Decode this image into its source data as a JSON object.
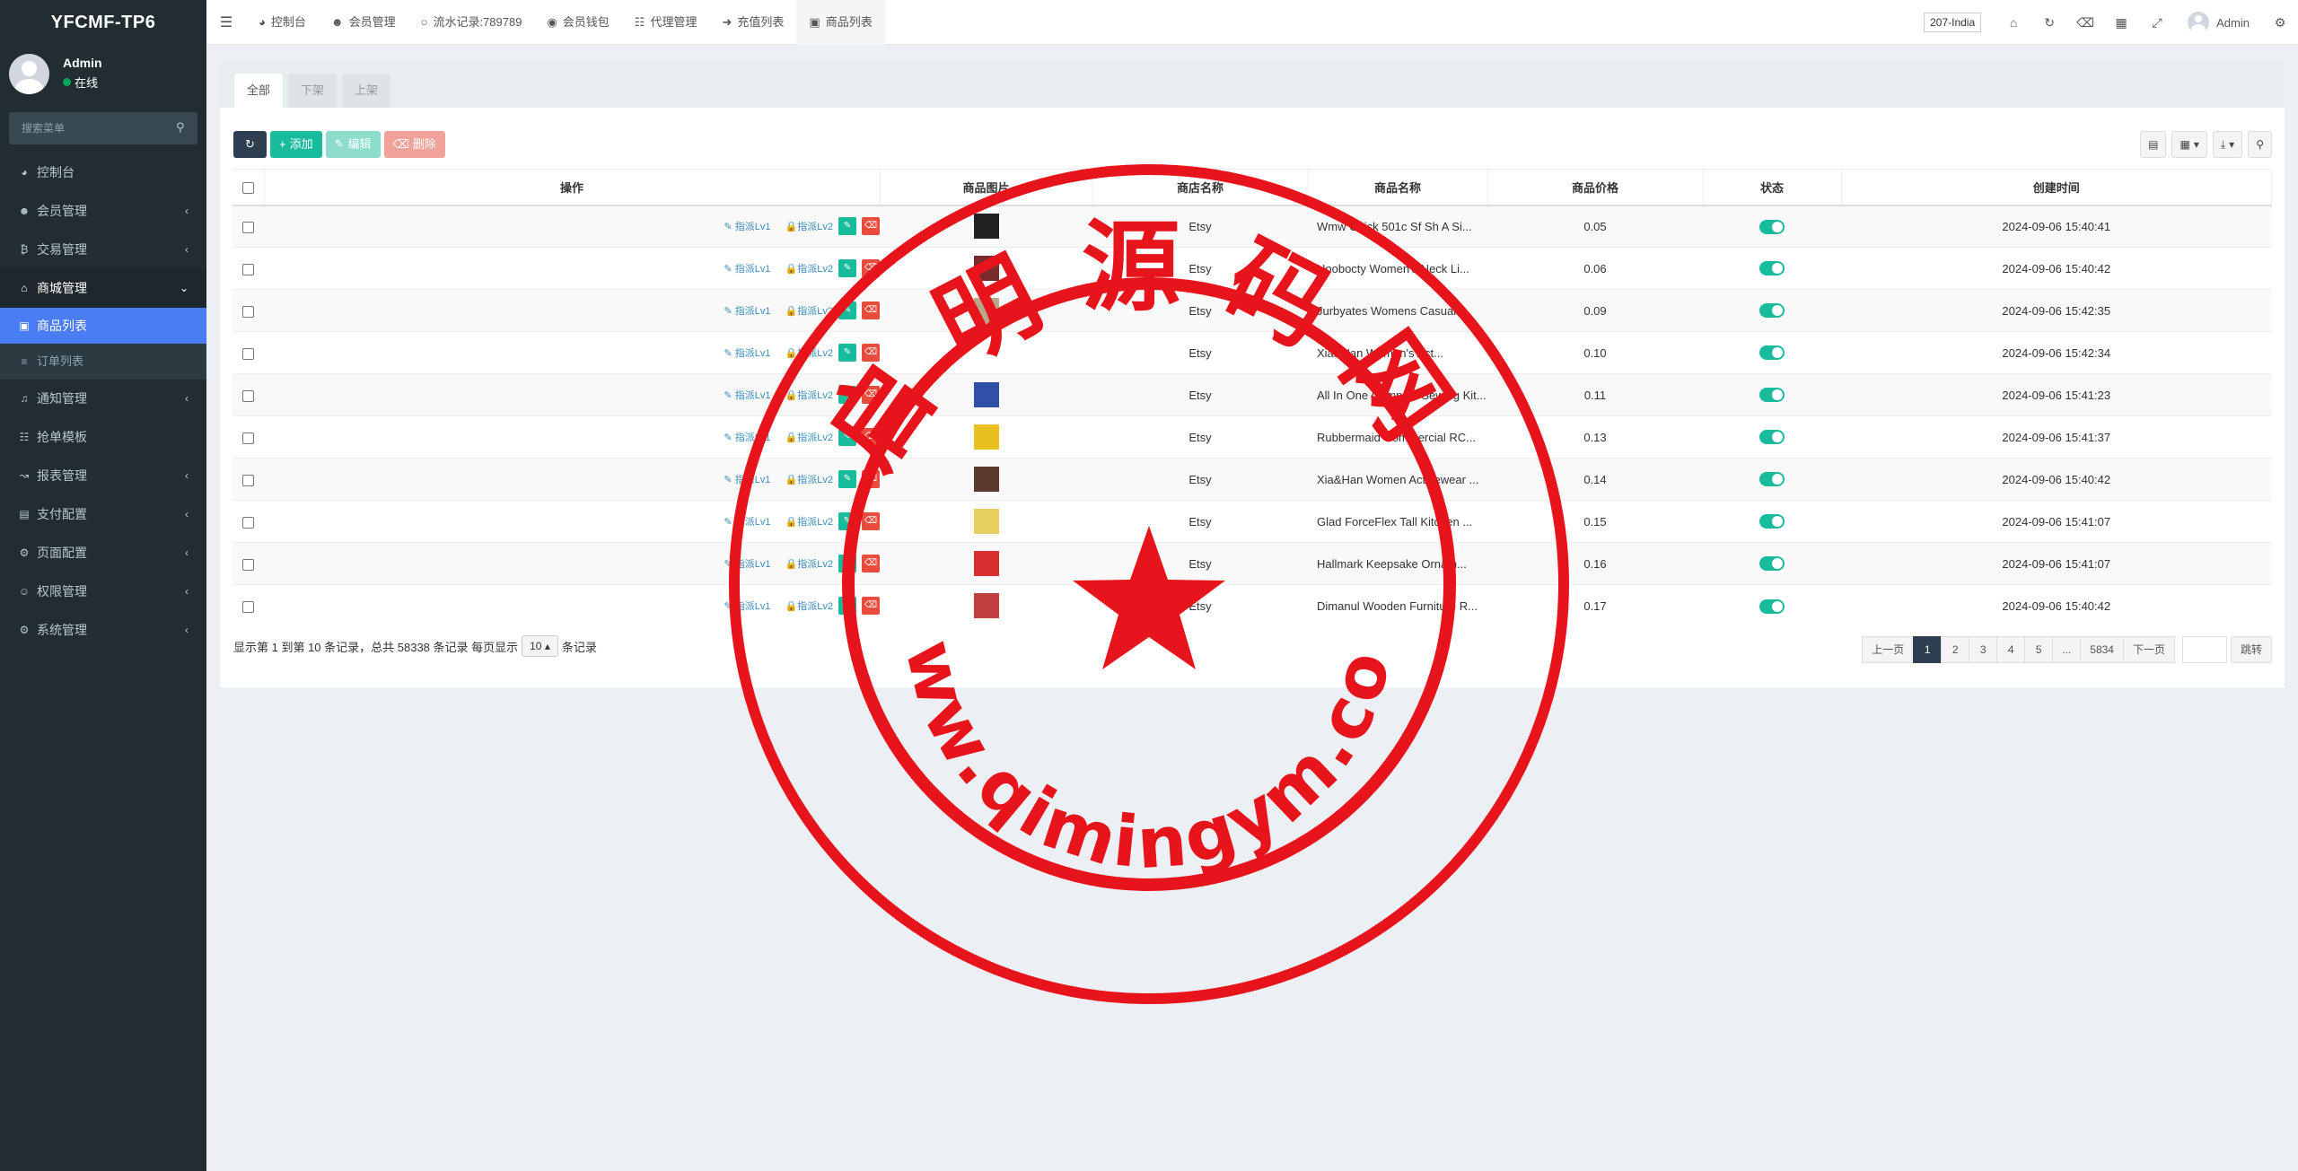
{
  "app": {
    "title": "YFCMF-TP6"
  },
  "user": {
    "name": "Admin",
    "status": "在线"
  },
  "sidebar": {
    "search_placeholder": "搜索菜单",
    "items": [
      {
        "label": "控制台",
        "icon": "dashboard-icon"
      },
      {
        "label": "会员管理",
        "icon": "user-circle-icon"
      },
      {
        "label": "交易管理",
        "icon": "bitcoin-icon"
      },
      {
        "label": "商城管理",
        "icon": "home-icon"
      },
      {
        "label": "商品列表",
        "icon": "desktop-icon"
      },
      {
        "label": "订单列表",
        "icon": "list-icon"
      },
      {
        "label": "通知管理",
        "icon": "bell-icon"
      },
      {
        "label": "抢单模板",
        "icon": "sitemap-icon"
      },
      {
        "label": "报表管理",
        "icon": "line-chart-icon"
      },
      {
        "label": "支付配置",
        "icon": "credit-card-icon"
      },
      {
        "label": "页面配置",
        "icon": "gear-icon"
      },
      {
        "label": "权限管理",
        "icon": "users-icon"
      },
      {
        "label": "系统管理",
        "icon": "cogs-icon"
      }
    ]
  },
  "header": {
    "tabs": [
      "控制台",
      "会员管理",
      "流水记录:789789",
      "会员钱包",
      "代理管理",
      "充值列表",
      "商品列表"
    ],
    "language": "207-India",
    "user": "Admin"
  },
  "panel": {
    "tabs": [
      "全部",
      "下架",
      "上架"
    ],
    "toolbar": {
      "add": "添加",
      "edit": "编辑",
      "delete": "删除"
    }
  },
  "table": {
    "columns": [
      "操作",
      "商品图片",
      "商店名称",
      "商品名称",
      "商品价格",
      "状态",
      "创建时间"
    ],
    "op_links": [
      "指派Lv1",
      "指派Lv2"
    ],
    "rows": [
      {
        "store": "Etsy",
        "name": "Wmw Chick 501c Sf Sh A Si...",
        "price": "0.05",
        "created": "2024-09-06 15:40:41",
        "thumb_color": "#222222"
      },
      {
        "store": "Etsy",
        "name": "Hoobocty Women's Neck Li...",
        "price": "0.06",
        "created": "2024-09-06 15:40:42",
        "thumb_color": "#7a2b2b"
      },
      {
        "store": "Etsy",
        "name": "Jurbyates Womens Casual...",
        "price": "0.09",
        "created": "2024-09-06 15:42:35",
        "thumb_color": "#b8a98a"
      },
      {
        "store": "Etsy",
        "name": "Xia&Han Women's Act...",
        "price": "0.10",
        "created": "2024-09-06 15:42:34",
        "thumb_color": "#ffffff"
      },
      {
        "store": "Etsy",
        "name": "All In One Compact Sewing Kit...",
        "price": "0.11",
        "created": "2024-09-06 15:41:23",
        "thumb_color": "#2f4fa8"
      },
      {
        "store": "Etsy",
        "name": "Rubbermaid Commercial RC...",
        "price": "0.13",
        "created": "2024-09-06 15:41:37",
        "thumb_color": "#e8c020"
      },
      {
        "store": "Etsy",
        "name": "Xia&Han Women Activewear ...",
        "price": "0.14",
        "created": "2024-09-06 15:40:42",
        "thumb_color": "#5a3a2a"
      },
      {
        "store": "Etsy",
        "name": "Glad ForceFlex Tall Kitchen ...",
        "price": "0.15",
        "created": "2024-09-06 15:41:07",
        "thumb_color": "#e8d060"
      },
      {
        "store": "Etsy",
        "name": "Hallmark Keepsake Ornam...",
        "price": "0.16",
        "created": "2024-09-06 15:41:07",
        "thumb_color": "#d83030"
      },
      {
        "store": "Etsy",
        "name": "Dimanul Wooden Furniture R...",
        "price": "0.17",
        "created": "2024-09-06 15:40:42",
        "thumb_color": "#c04040"
      }
    ]
  },
  "pager": {
    "info": "显示第 1 到第 10 条记录，总共 58338 条记录 每页显示",
    "page_size": "10",
    "suffix": "条记录",
    "prev": "上一页",
    "pages": [
      "1",
      "2",
      "3",
      "4",
      "5",
      "...",
      "5834"
    ],
    "next": "下一页",
    "jump": "跳转"
  },
  "watermark": {
    "chars": [
      "启",
      "明",
      "源",
      "码",
      "网"
    ],
    "url": "www.qimingym.com",
    "color": "#e8141c"
  }
}
